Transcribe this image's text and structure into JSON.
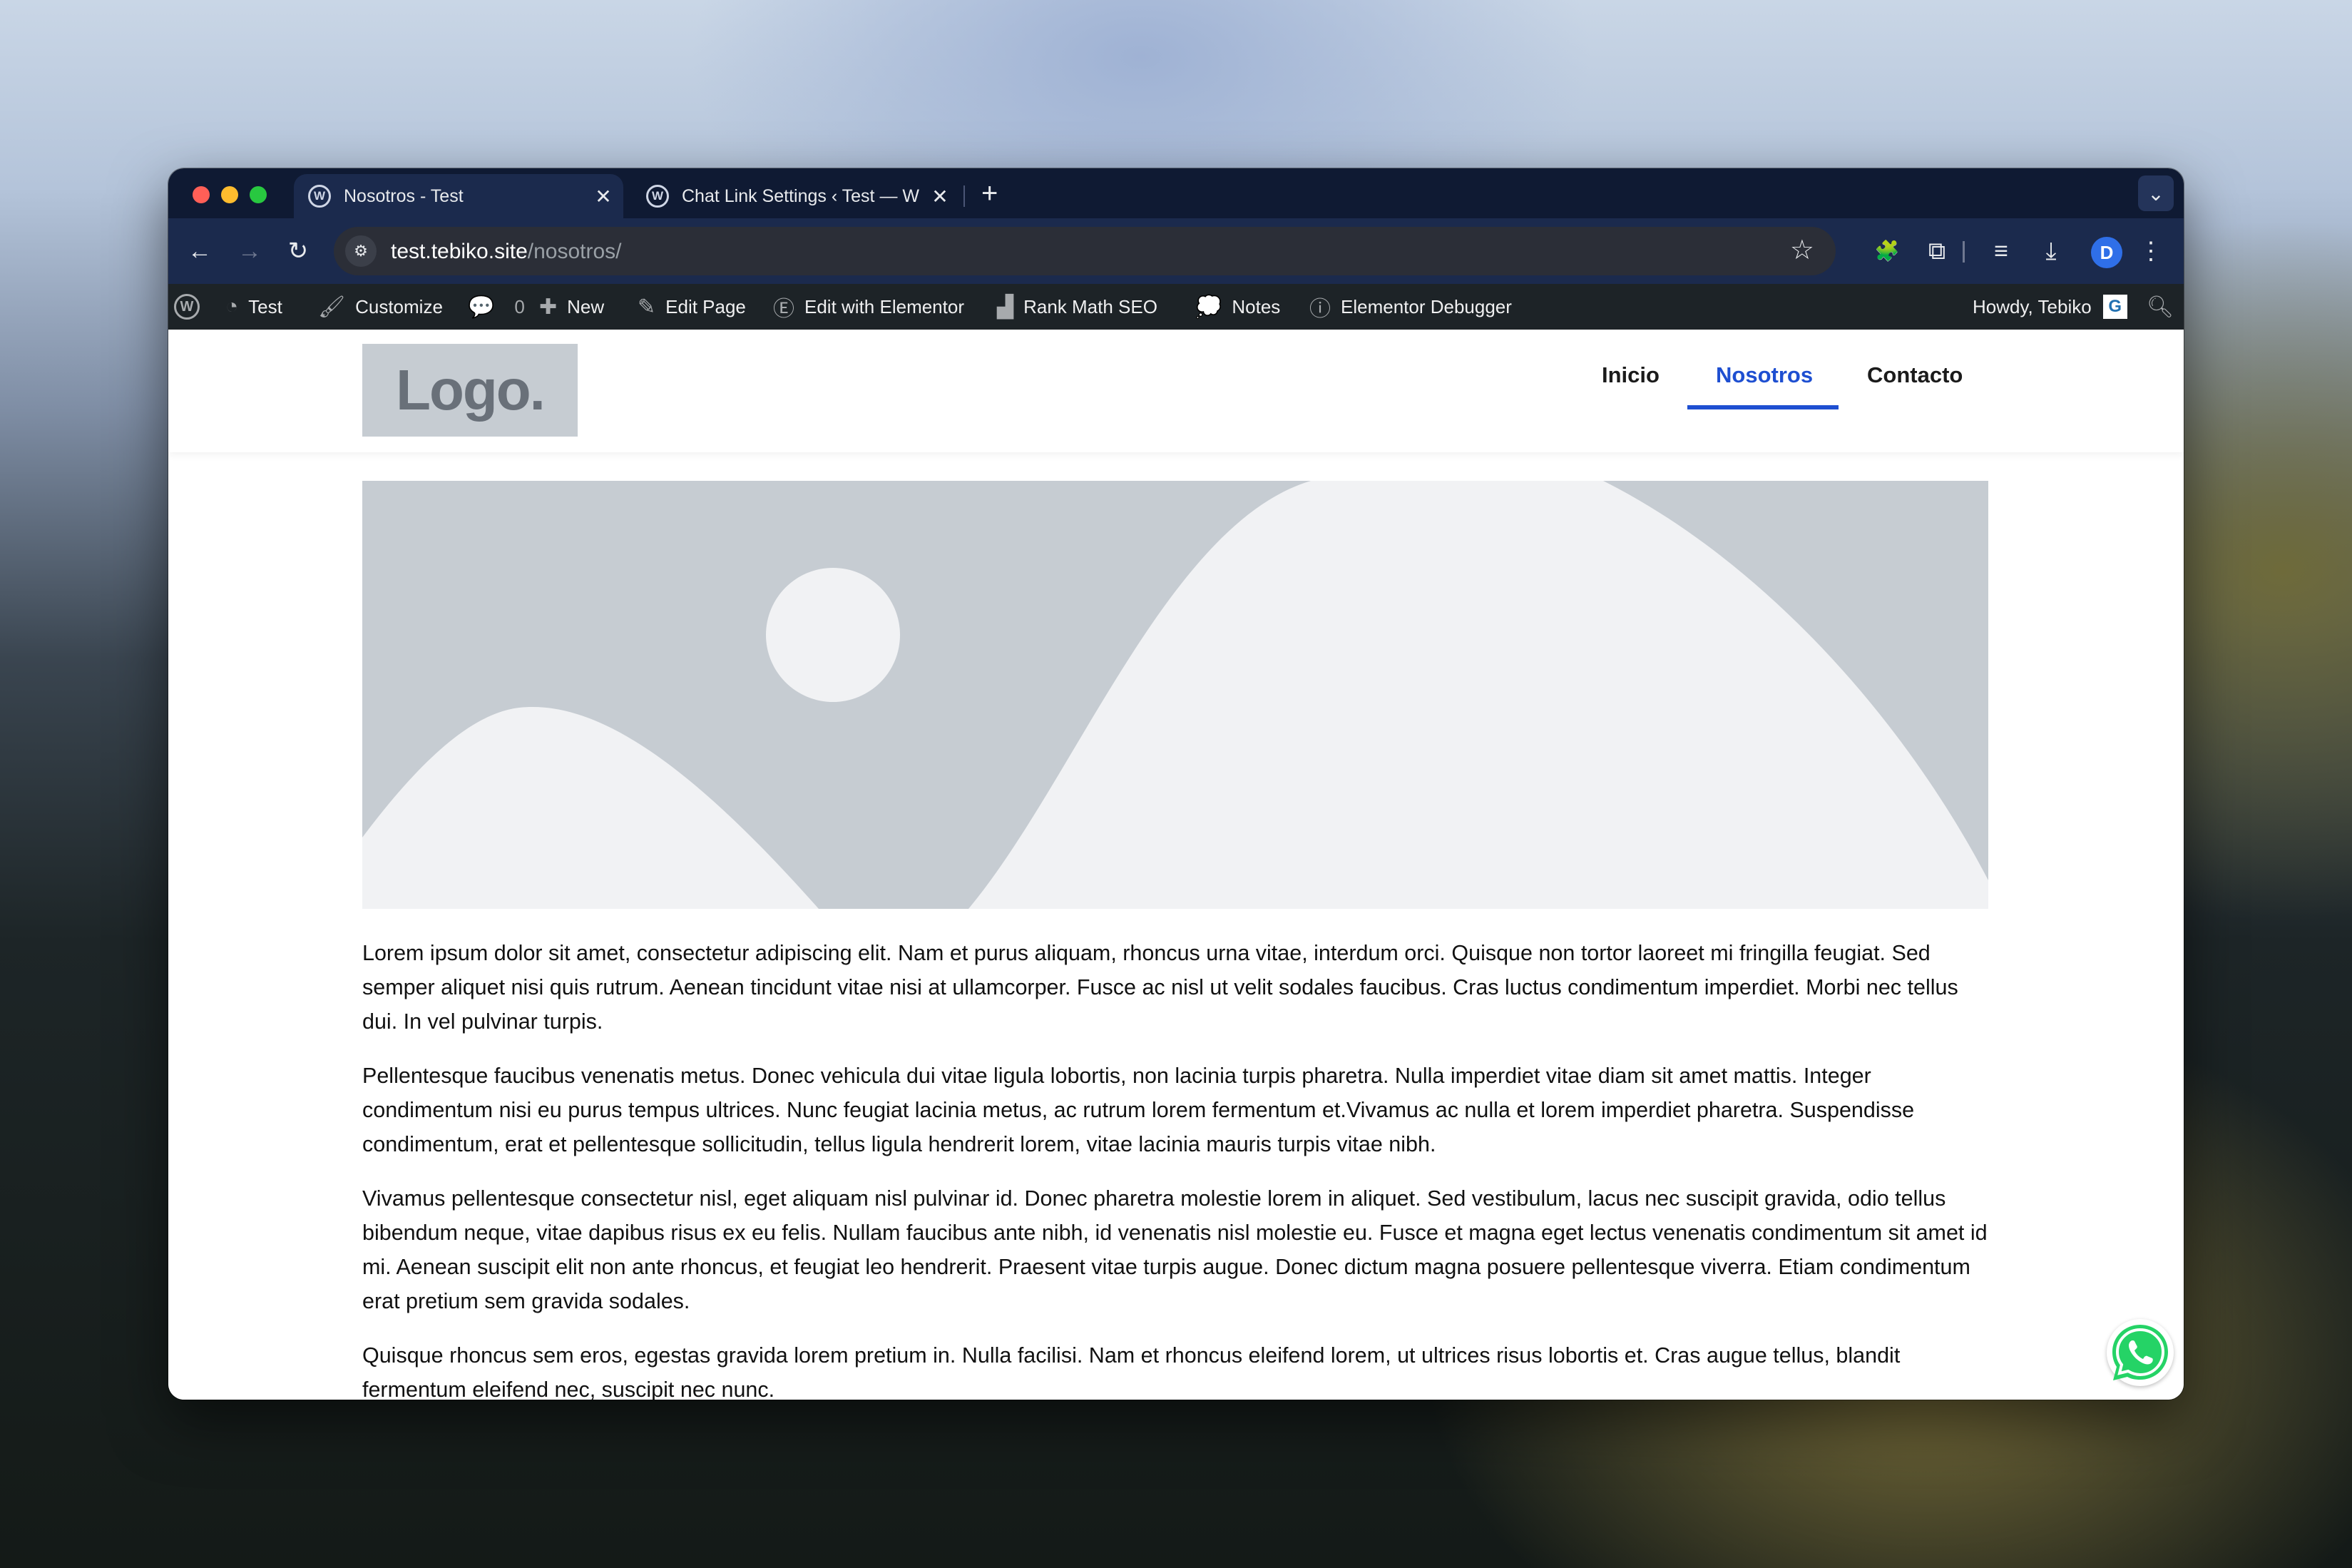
{
  "browser": {
    "tabs": [
      {
        "title": "Nosotros - Test",
        "active": true
      },
      {
        "title": "Chat Link Settings ‹ Test — W",
        "active": false
      }
    ],
    "url_host": "test.tebiko.site",
    "url_path": "/nosotros/",
    "profile_initial": "D"
  },
  "adminbar": {
    "site_name": "Test",
    "customize": "Customize",
    "comments_count": "0",
    "new": "New",
    "edit_page": "Edit Page",
    "edit_elementor": "Edit with Elementor",
    "rank_math": "Rank Math SEO",
    "notes": "Notes",
    "elementor_debugger": "Elementor Debugger",
    "howdy": "Howdy, Tebiko"
  },
  "site": {
    "logo_text": "Logo.",
    "nav": [
      {
        "label": "Inicio"
      },
      {
        "label": "Nosotros",
        "active": true
      },
      {
        "label": "Contacto"
      }
    ],
    "paragraphs": [
      "Lorem ipsum dolor sit amet, consectetur adipiscing elit. Nam et purus aliquam, rhoncus urna vitae, interdum orci. Quisque non tortor laoreet mi fringilla feugiat. Sed semper aliquet nisi quis rutrum. Aenean tincidunt vitae nisi at ullamcorper. Fusce ac nisl ut velit sodales faucibus. Cras luctus condimentum imperdiet. Morbi nec tellus dui. In vel pulvinar turpis.",
      "Pellentesque faucibus venenatis metus. Donec vehicula dui vitae ligula lobortis, non lacinia turpis pharetra. Nulla imperdiet vitae diam sit amet mattis. Integer condimentum nisi eu purus tempus ultrices. Nunc feugiat lacinia metus, ac rutrum lorem fermentum et.Vivamus ac nulla et lorem imperdiet pharetra. Suspendisse condimentum, erat et pellentesque sollicitudin, tellus ligula hendrerit lorem, vitae lacinia mauris turpis vitae nibh.",
      "Vivamus pellentesque consectetur nisl, eget aliquam nisl pulvinar id. Donec pharetra molestie lorem in aliquet. Sed vestibulum, lacus nec suscipit gravida, odio tellus bibendum neque, vitae dapibus risus ex eu felis. Nullam faucibus ante nibh, id venenatis nisl molestie eu. Fusce et magna eget lectus venenatis condimentum sit amet id mi. Aenean suscipit elit non ante rhoncus, et feugiat leo hendrerit. Praesent vitae turpis augue. Donec dictum magna posuere pellentesque viverra. Etiam condimentum erat pretium sem gravida sodales.",
      "Quisque rhoncus sem eros, egestas gravida lorem pretium in. Nulla facilisi. Nam et rhoncus eleifend lorem, ut ultrices risus lobortis et. Cras augue tellus, blandit fermentum eleifend nec, suscipit nec nunc."
    ]
  },
  "colors": {
    "nav_active": "#1e4fd1",
    "placeholder_bg": "#c6ccd2",
    "placeholder_fg": "#f1f2f4",
    "whatsapp": "#25d366"
  }
}
